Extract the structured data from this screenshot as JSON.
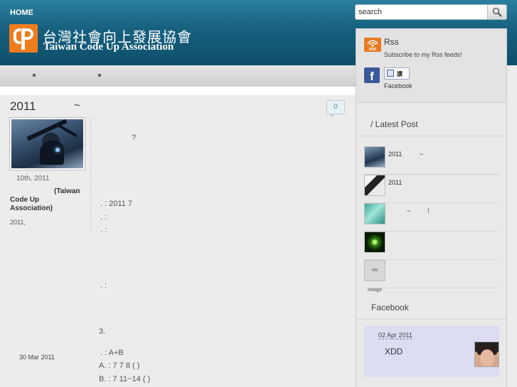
{
  "header": {
    "home_label": "HOME",
    "logo_zh": "台灣社會向上發展協會",
    "logo_en": "Taiwan Code Up Association",
    "search_placeholder": "search"
  },
  "post": {
    "title": "2011",
    "title_tilde": "~",
    "comment_count": "0",
    "date": "10th, 2011",
    "author_line1": "(Taiwan",
    "author_line2": "Code Up",
    "author_line3": "Association)",
    "meta": "2011,",
    "body": [
      "?",
      ".    : 2011  7",
      ".    :",
      ".    :",
      ".    :",
      "3.",
      ".    : A+B",
      "A.    : 7  7  8  (  )",
      "B.    : 7  11~14  (  )"
    ]
  },
  "sidebar": {
    "rss_title": "Rss",
    "rss_icon_label": "RSS",
    "rss_desc": "Subscribe to my Rss feeds!",
    "fb_like_label": "讚",
    "facebook_label": "Facebook",
    "latest_title": "/ Latest Post",
    "latest_posts": [
      {
        "text": "2011",
        "tilde": "~"
      },
      {
        "text": "2011",
        "tilde": ""
      },
      {
        "text": "~",
        "tilde": "!"
      },
      {
        "text": "",
        "tilde": ""
      },
      {
        "text": "",
        "tilde": ""
      }
    ],
    "no_image_label": "no image",
    "facebook_title": "Facebook",
    "fb_post_date": "02 Apr 2011",
    "fb_post_text": "XDD",
    "fb_next_date": "30 Mar 2011"
  },
  "colors": {
    "header_blue": "#16607e",
    "logo_orange": "#ef7d1e",
    "facebook_blue": "#3b5998",
    "fb_post_bg": "#dcdcf2"
  },
  "icons": [
    "search-icon",
    "rss-icon",
    "facebook-icon",
    "like-thumb-icon"
  ]
}
